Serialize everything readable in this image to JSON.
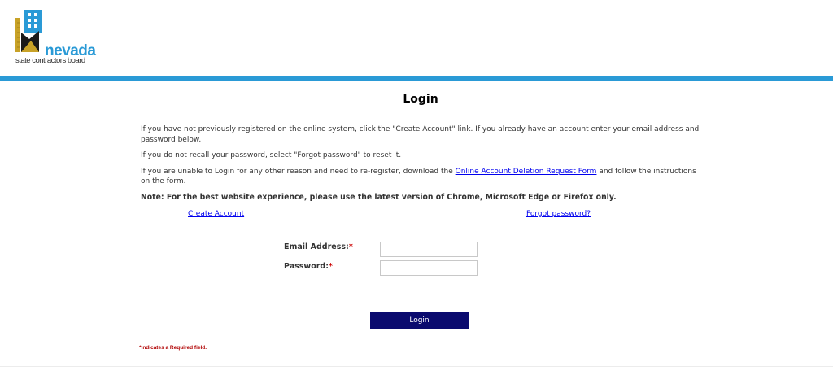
{
  "header": {
    "logo_word": "nevada",
    "logo_subtitle": "state contractors board",
    "colors": {
      "brand_blue": "#2a9ad6",
      "logo_gold": "#c8a227",
      "logo_dark": "#1a1a1a"
    }
  },
  "page": {
    "title": "Login",
    "intro": "If you have not previously registered on the online system, click the \"Create Account\" link. If you already have an account enter your email address and password below.",
    "forgot_hint": "If you do not recall your password, select \"Forgot password\" to reset it.",
    "reregister_prefix": "If you are unable to Login for any other reason and need to re-register, download the ",
    "reregister_link": "Online Account Deletion Request Form",
    "reregister_suffix": " and follow the instructions on the form.",
    "note": "Note: For the best website experience, please use the latest version of Chrome, Microsoft Edge or Firefox only."
  },
  "links": {
    "create_account": "Create Account",
    "forgot_password": "Forgot password?"
  },
  "form": {
    "email_label": "Email Address:",
    "password_label": "Password:",
    "required_mark": "*",
    "email_value": "",
    "password_value": "",
    "login_button": "Login",
    "colors": {
      "button_bg": "#0a0a6e",
      "required": "#cc0000"
    }
  },
  "footer": {
    "required_note": "*Indicates a Required field."
  }
}
